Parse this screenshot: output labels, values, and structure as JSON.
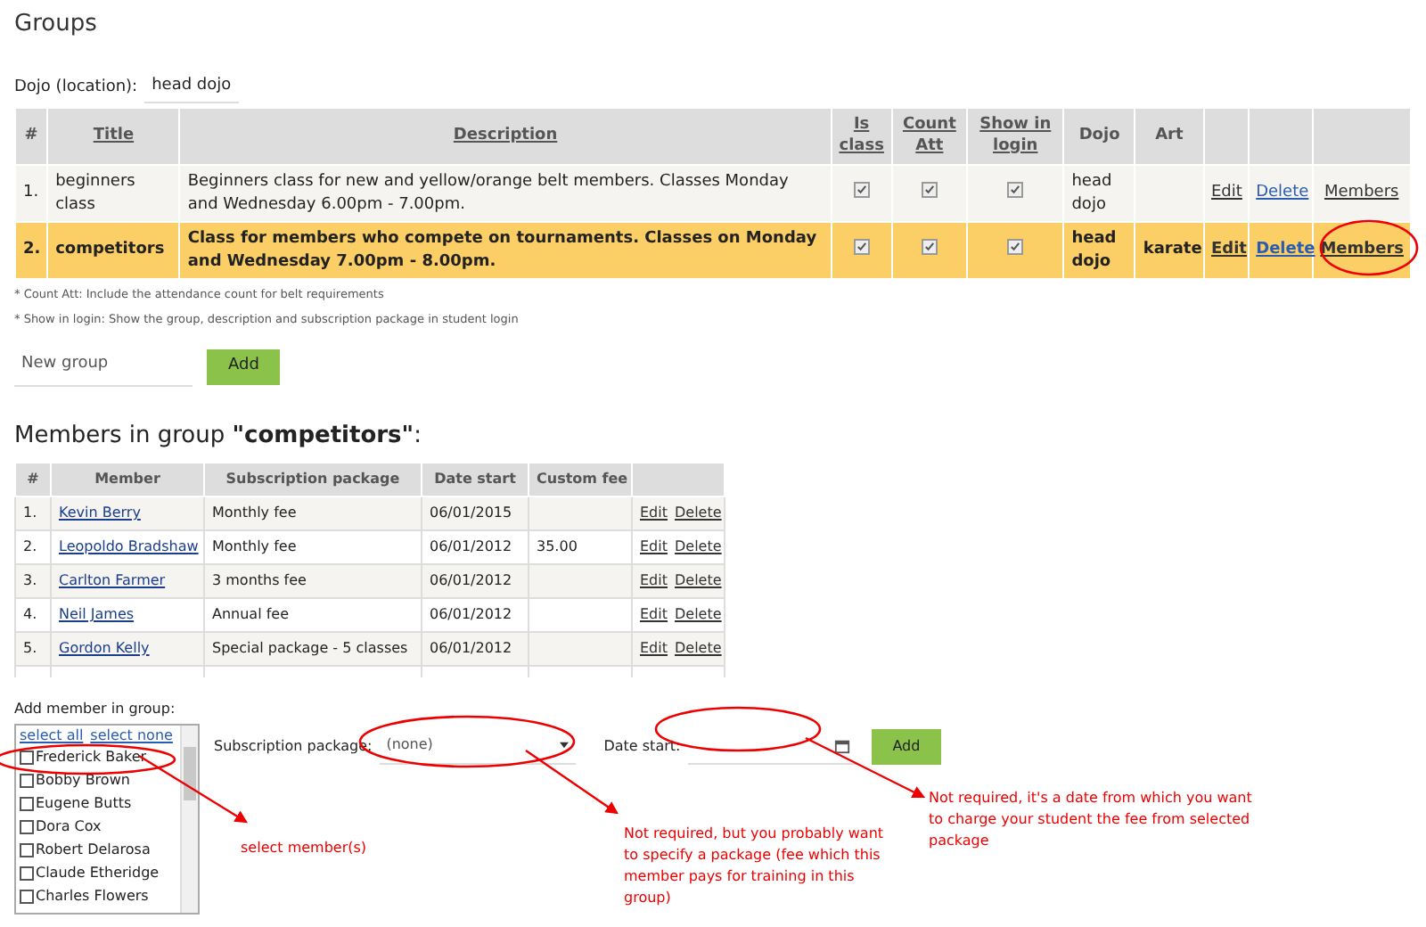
{
  "title": "Groups",
  "dojo": {
    "label": "Dojo (location):",
    "value": "head dojo"
  },
  "groups_table": {
    "columns": [
      {
        "label": "#",
        "link": false
      },
      {
        "label": "Title",
        "link": true
      },
      {
        "label": "Description",
        "link": true
      },
      {
        "label": "Is class",
        "link": true
      },
      {
        "label": "Count Att",
        "link": true
      },
      {
        "label": "Show in login",
        "link": true
      },
      {
        "label": "Dojo",
        "link": false
      },
      {
        "label": "Art",
        "link": false
      }
    ],
    "rows": [
      {
        "number": "1.",
        "title": "beginners class",
        "description": "Beginners class for new and yellow/orange belt members. Classes Monday and Wednesday 6.00pm - 7.00pm.",
        "is_class": true,
        "count_att": true,
        "show_in_login": true,
        "dojo": "head dojo",
        "art": "",
        "actions": [
          "Edit",
          "Delete",
          "Members"
        ],
        "selected": false
      },
      {
        "number": "2.",
        "title": "competitors",
        "description": "Class for members who compete on tournaments. Classes on Monday and Wednesday 7.00pm - 8.00pm.",
        "is_class": true,
        "count_att": true,
        "show_in_login": true,
        "dojo": "head dojo",
        "art": "karate",
        "actions": [
          "Edit",
          "Delete",
          "Members"
        ],
        "selected": true
      }
    ]
  },
  "notes": [
    "* Count Att: Include the attendance count for belt requirements",
    "* Show in login: Show the group, description and subscription package in student login"
  ],
  "new_group": {
    "placeholder": "New group",
    "button": "Add"
  },
  "members_heading": "Members in group **\"competitors\"**:",
  "members_table": {
    "columns": [
      "#",
      "Member",
      "Subscription package",
      "Date start",
      "Custom fee"
    ],
    "rows": [
      {
        "number": "1.",
        "member": "Kevin Berry",
        "package": "Monthly fee",
        "date_start": "06/01/2015",
        "custom_fee": "",
        "actions": [
          "Edit",
          "Delete"
        ]
      },
      {
        "number": "2.",
        "member": "Leopoldo Bradshaw",
        "package": "Monthly fee",
        "date_start": "06/01/2012",
        "custom_fee": "35.00",
        "actions": [
          "Edit",
          "Delete"
        ]
      },
      {
        "number": "3.",
        "member": "Carlton Farmer",
        "package": "3 months fee",
        "date_start": "06/01/2012",
        "custom_fee": "",
        "actions": [
          "Edit",
          "Delete"
        ]
      },
      {
        "number": "4.",
        "member": "Neil James",
        "package": "Annual fee",
        "date_start": "06/01/2012",
        "custom_fee": "",
        "actions": [
          "Edit",
          "Delete"
        ]
      },
      {
        "number": "5.",
        "member": "Gordon Kelly",
        "package": "Special package - 5 classes",
        "date_start": "06/01/2012",
        "custom_fee": "",
        "actions": [
          "Edit",
          "Delete"
        ]
      }
    ]
  },
  "add_member": {
    "label": "Add member in group:",
    "select_all": "select all",
    "select_none": "select none",
    "members": [
      {
        "name": "Frederick Baker",
        "checked": false
      },
      {
        "name": "Bobby Brown",
        "checked": false
      },
      {
        "name": "Eugene Butts",
        "checked": false
      },
      {
        "name": "Dora Cox",
        "checked": false
      },
      {
        "name": "Robert Delarosa",
        "checked": false
      },
      {
        "name": "Claude Etheridge",
        "checked": false
      },
      {
        "name": "Charles Flowers",
        "checked": false
      }
    ],
    "package_label": "Subscription package:",
    "package_value": "(none)",
    "date_label": "Date start:",
    "button": "Add"
  },
  "annotations": [
    "select member(s)",
    "Not required, but you probably want to specify a package (fee which this member pays for training in this group)",
    "Not required, it's a date from which you want to charge your student the fee from selected package"
  ]
}
